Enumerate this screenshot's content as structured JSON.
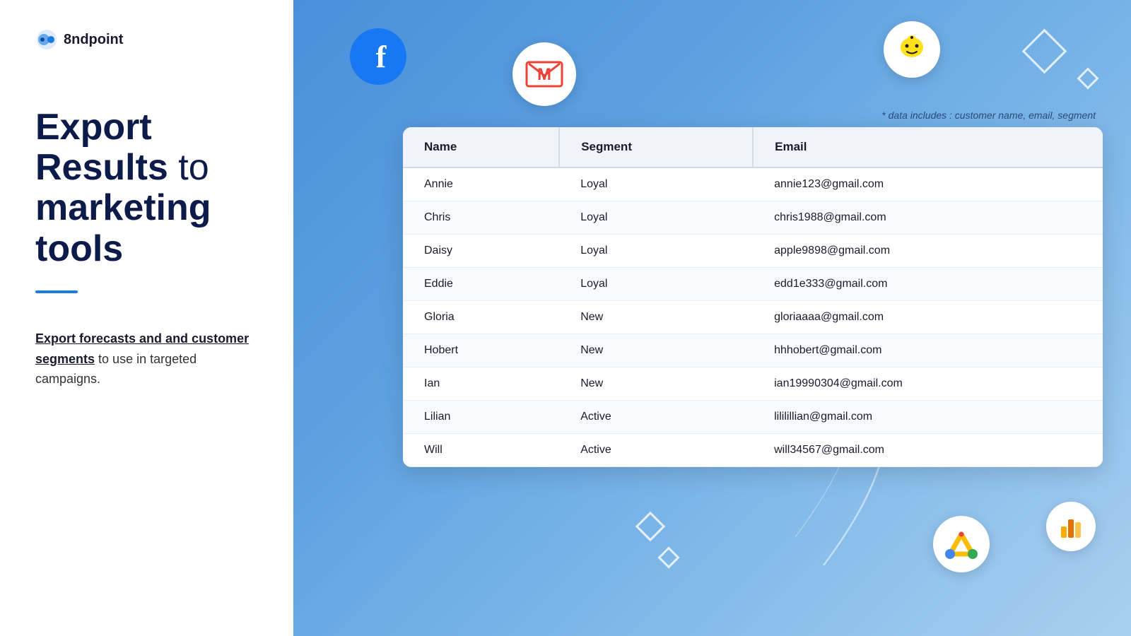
{
  "logo": {
    "text": "8ndpoint"
  },
  "left": {
    "heading_line1": "Export",
    "heading_line2": "Results",
    "heading_to": "to",
    "heading_line3": "marketing tools",
    "description_underlined": "Export forecasts and and customer segments",
    "description_rest": " to use in targeted campaigns."
  },
  "data_note": "* data includes : customer name, email, segment",
  "table": {
    "columns": [
      "Name",
      "Segment",
      "Email"
    ],
    "rows": [
      {
        "name": "Annie",
        "segment": "Loyal",
        "email": "annie123@gmail.com"
      },
      {
        "name": "Chris",
        "segment": "Loyal",
        "email": "chris1988@gmail.com"
      },
      {
        "name": "Daisy",
        "segment": "Loyal",
        "email": "apple9898@gmail.com"
      },
      {
        "name": "Eddie",
        "segment": "Loyal",
        "email": "edd1e333@gmail.com"
      },
      {
        "name": "Gloria",
        "segment": "New",
        "email": "gloriaaaa@gmail.com"
      },
      {
        "name": "Hobert",
        "segment": "New",
        "email": "hhhobert@gmail.com"
      },
      {
        "name": "Ian",
        "segment": "New",
        "email": "ian19990304@gmail.com"
      },
      {
        "name": "Lilian",
        "segment": "Active",
        "email": "lililillian@gmail.com"
      },
      {
        "name": "Will",
        "segment": "Active",
        "email": "will34567@gmail.com"
      }
    ]
  }
}
